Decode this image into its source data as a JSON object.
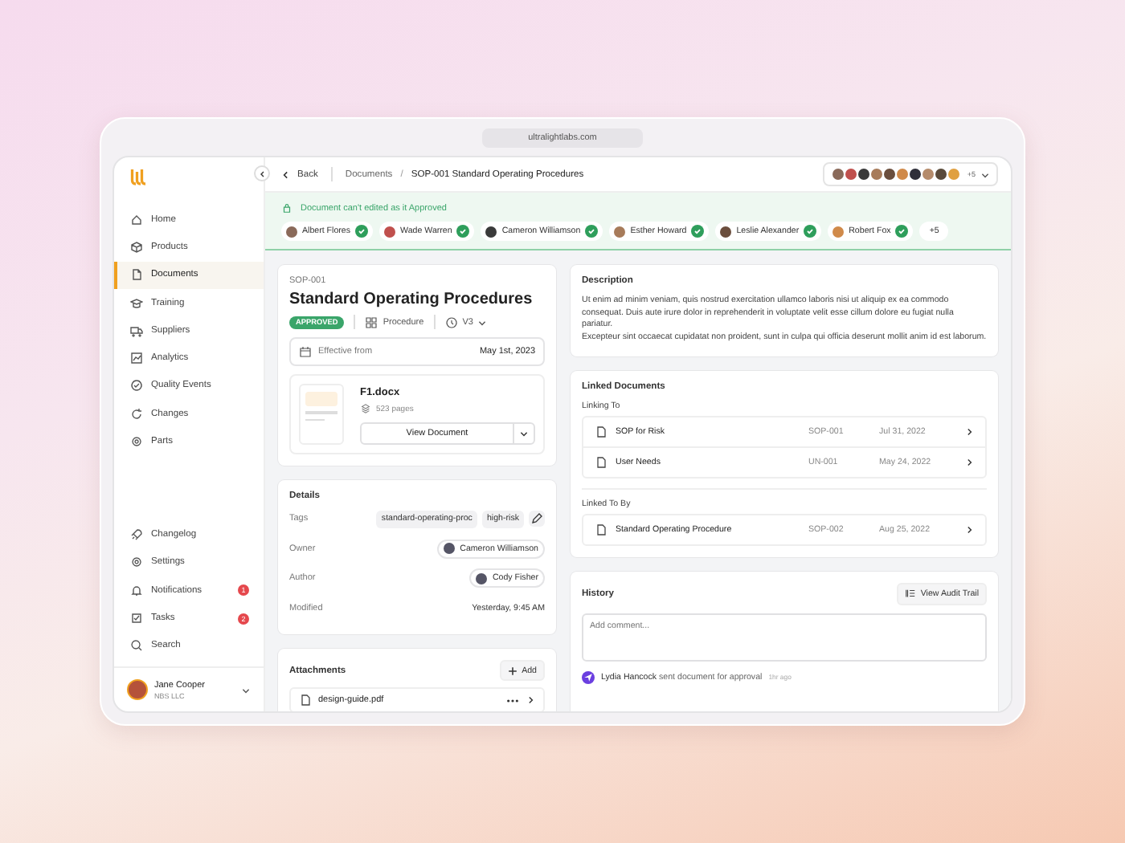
{
  "browser": {
    "url": "ultralightlabs.com"
  },
  "sidebar": {
    "items": [
      {
        "label": "Home",
        "selected": false
      },
      {
        "label": "Products",
        "selected": false
      },
      {
        "label": "Documents",
        "selected": true
      },
      {
        "label": "Training",
        "selected": false
      },
      {
        "label": "Suppliers",
        "selected": false
      },
      {
        "label": "Analytics",
        "selected": false
      },
      {
        "label": "Quality Events",
        "selected": false
      },
      {
        "label": "Changes",
        "selected": false
      },
      {
        "label": "Parts",
        "selected": false
      }
    ],
    "bottom_items": [
      {
        "label": "Changelog"
      },
      {
        "label": "Settings"
      },
      {
        "label": "Notifications",
        "badge": "1"
      },
      {
        "label": "Tasks",
        "badge": "2"
      },
      {
        "label": "Search"
      }
    ],
    "user": {
      "name": "Jane Cooper",
      "org": "NBS LLC"
    }
  },
  "topbar": {
    "back": "Back",
    "breadcrumb": [
      "Documents",
      "SOP-001 Standard Operating Procedures"
    ],
    "separator": "/",
    "avatar_more": "+5"
  },
  "banner": {
    "message": "Document can't edited as it Approved",
    "approvers": [
      {
        "name": "Albert Flores",
        "approved": true
      },
      {
        "name": "Wade Warren",
        "approved": true
      },
      {
        "name": "Cameron Williamson",
        "approved": true
      },
      {
        "name": "Esther Howard",
        "approved": true
      },
      {
        "name": "Leslie Alexander",
        "approved": true
      },
      {
        "name": "Robert Fox",
        "approved": true
      }
    ],
    "more": "+5"
  },
  "document": {
    "code": "SOP-001",
    "title": "Standard Operating Procedures",
    "status": "APPROVED",
    "type": "Procedure",
    "version": "V3",
    "effective_label": "Effective from",
    "effective_date": "May 1st, 2023",
    "file": {
      "name": "F1.docx",
      "pages": "523 pages",
      "button": "View Document"
    }
  },
  "details": {
    "title": "Details",
    "tags_label": "Tags",
    "tags": [
      "standard-operating-proc",
      "high-risk"
    ],
    "rows": [
      {
        "label": "Owner",
        "kind": "person",
        "value": "Cameron Williamson"
      },
      {
        "label": "Author",
        "kind": "person",
        "value": "Cody Fisher"
      },
      {
        "label": "Modified",
        "kind": "text",
        "value": "Yesterday, 9:45 AM"
      }
    ]
  },
  "attachments": {
    "title": "Attachments",
    "add": "Add",
    "files": [
      {
        "name": "design-guide.pdf"
      }
    ]
  },
  "description": {
    "title": "Description",
    "paragraphs": [
      "Ut enim ad minim veniam, quis nostrud exercitation ullamco laboris nisi ut aliquip ex ea commodo consequat. Duis aute irure dolor in reprehenderit in voluptate velit esse cillum dolore eu fugiat nulla pariatur.",
      "Excepteur sint occaecat cupidatat non proident, sunt in culpa qui officia deserunt mollit anim id est laborum."
    ]
  },
  "linked": {
    "title": "Linked Documents",
    "groups": [
      {
        "label": "Linking To",
        "rows": [
          {
            "name": "SOP for Risk",
            "code": "SOP-001",
            "date": "Jul 31, 2022"
          },
          {
            "name": "User Needs",
            "code": "UN-001",
            "date": "May 24, 2022"
          }
        ]
      },
      {
        "label": "Linked To By",
        "rows": [
          {
            "name": "Standard Operating Procedure",
            "code": "SOP-002",
            "date": "Aug 25, 2022"
          }
        ]
      }
    ]
  },
  "history": {
    "title": "History",
    "audit_button": "View Audit Trail",
    "placeholder": "Add comment...",
    "events": [
      {
        "user": "Lydia Hancock",
        "action": "sent document for approval",
        "time": "1hr ago"
      }
    ]
  }
}
